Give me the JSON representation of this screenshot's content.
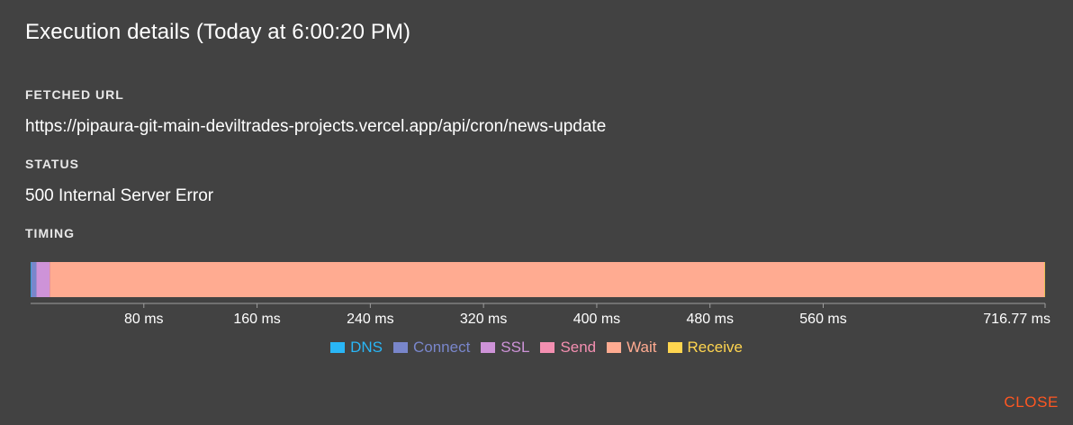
{
  "dialog": {
    "title": "Execution details (Today at 6:00:20 PM)"
  },
  "fetched_url": {
    "label": "FETCHED URL",
    "value": "https://pipaura-git-main-deviltrades-projects.vercel.app/api/cron/news-update"
  },
  "status": {
    "label": "STATUS",
    "value": "500 Internal Server Error"
  },
  "timing": {
    "label": "TIMING",
    "total_ms": 716.77,
    "ticks": [
      {
        "value": 80,
        "label": "80 ms"
      },
      {
        "value": 160,
        "label": "160 ms"
      },
      {
        "value": 240,
        "label": "240 ms"
      },
      {
        "value": 320,
        "label": "320 ms"
      },
      {
        "value": 400,
        "label": "400 ms"
      },
      {
        "value": 480,
        "label": "480 ms"
      },
      {
        "value": 560,
        "label": "560 ms"
      },
      {
        "value": 716.77,
        "label": "716.77 ms"
      }
    ],
    "segments": [
      {
        "name": "DNS",
        "color": "#29b6f6",
        "duration_ms": 0.5
      },
      {
        "name": "Connect",
        "color": "#7986cb",
        "duration_ms": 3.6
      },
      {
        "name": "SSL",
        "color": "#ce93d8",
        "duration_ms": 9.3
      },
      {
        "name": "Send",
        "color": "#f48fb1",
        "duration_ms": 0.3
      },
      {
        "name": "Wait",
        "color": "#ffab91",
        "duration_ms": 702.57
      },
      {
        "name": "Receive",
        "color": "#ffd54f",
        "duration_ms": 0.5
      }
    ]
  },
  "actions": {
    "close_label": "CLOSE"
  }
}
